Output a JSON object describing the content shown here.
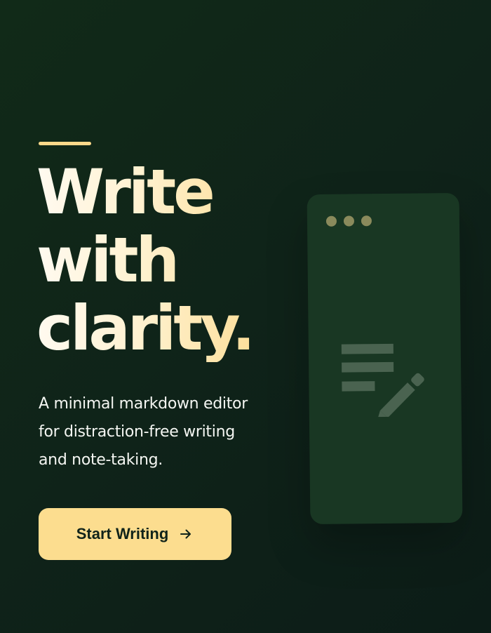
{
  "hero": {
    "headline_line1": "Write",
    "headline_line2": "with",
    "headline_line3": "clarity.",
    "subtitle": "A minimal markdown editor for distraction-free writing and note-taking."
  },
  "cta": {
    "label": "Start Writing",
    "icon": "arrow-right-icon"
  },
  "illustration": {
    "icons": [
      "window-dots-icon",
      "document-edit-icon"
    ]
  },
  "colors": {
    "background": "#0f2319",
    "accent": "#fcdd8f",
    "card": "#193723",
    "icon_muted": "#4a6350",
    "dot": "#8a8a5c"
  }
}
